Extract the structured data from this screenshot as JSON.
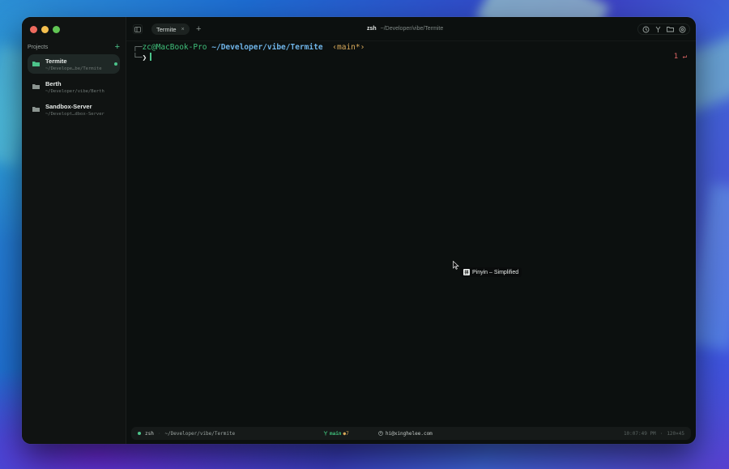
{
  "window": {
    "title_shell": "zsh",
    "title_path": "~/Developer/vibe/Termite"
  },
  "sidebar": {
    "section_label": "Projects",
    "add_label": "+",
    "projects": [
      {
        "name": "Termite",
        "path": "~/Develope…be/Termite",
        "active": true
      },
      {
        "name": "Berth",
        "path": "~/Developer/vibe/Berth",
        "active": false
      },
      {
        "name": "Sandbox-Server",
        "path": "~/Developt…dbox-Server",
        "active": false
      }
    ]
  },
  "tabs": [
    {
      "label": "Termite",
      "close": "×"
    }
  ],
  "new_tab_label": "+",
  "terminal": {
    "box_top": "┌─",
    "user": "zc@MacBook-Pro",
    "cwd": "~/Developer/vibe/Termite",
    "branch": "‹main*›",
    "box_bottom": "└─",
    "prompt": "❯",
    "rprompt": "1 ↵"
  },
  "ime": {
    "icon": "拼",
    "label": "Pinyin – Simplified"
  },
  "status": {
    "shell": "zsh",
    "path": "~/Developer/vibe/Termite",
    "branch": "main",
    "dirty": "●7",
    "email": "hi@xinghelee.com",
    "time": "10:07:49 PM",
    "size": "120×45"
  },
  "colors": {
    "accent": "#4cc38a",
    "user": "#3fbf7a",
    "cwd": "#6fb4e8",
    "branch": "#d8a95a",
    "error": "#e06666"
  },
  "icons": {
    "sidebar_toggle": "sidebar-toggle-icon",
    "history": "history-icon",
    "branch": "git-branch-icon",
    "folder": "folder-icon",
    "settings": "settings-icon"
  }
}
